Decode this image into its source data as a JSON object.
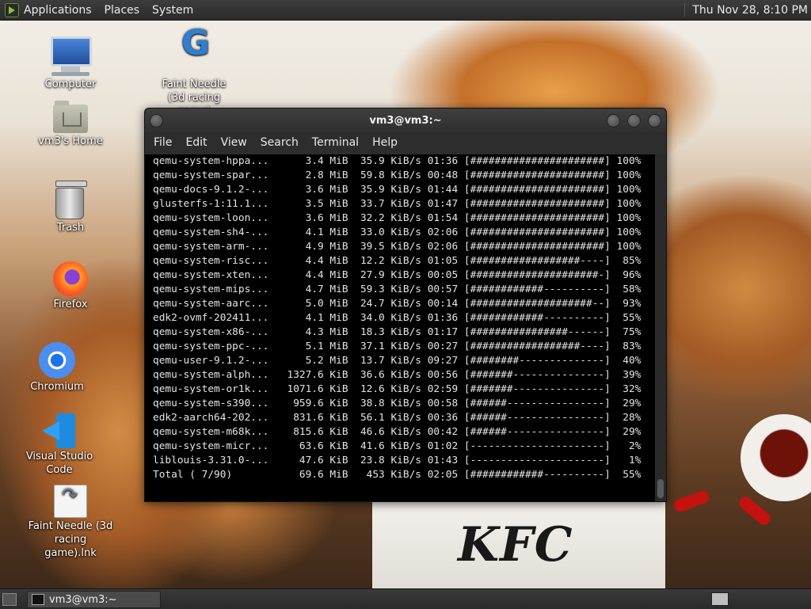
{
  "top_panel": {
    "menus": [
      "Applications",
      "Places",
      "System"
    ],
    "clock": "Thu Nov 28,  8:10 PM"
  },
  "desktop_icons": [
    {
      "label": "Computer",
      "icon": "computer-icon"
    },
    {
      "label": "Faint Needle (3d racing game)",
      "icon": "game-icon"
    },
    {
      "label": "vm3's Home",
      "icon": "home-folder-icon"
    },
    {
      "label": "Trash",
      "icon": "trash-icon"
    },
    {
      "label": "Firefox",
      "icon": "firefox-icon"
    },
    {
      "label": "Chromium",
      "icon": "chromium-icon"
    },
    {
      "label": "Visual Studio Code",
      "icon": "vscode-icon"
    },
    {
      "label": "Faint Needle (3d racing game).lnk",
      "icon": "shortcut-file-icon"
    }
  ],
  "wallpaper": {
    "brand_text": "KFC"
  },
  "terminal": {
    "title": "vm3@vm3:~",
    "menu": [
      "File",
      "Edit",
      "View",
      "Search",
      "Terminal",
      "Help"
    ],
    "lines": [
      "qemu-system-hppa...      3.4 MiB  35.9 KiB/s 01:36 [######################] 100%",
      "qemu-system-spar...      2.8 MiB  59.8 KiB/s 00:48 [######################] 100%",
      "qemu-docs-9.1.2-...      3.6 MiB  35.9 KiB/s 01:44 [######################] 100%",
      "glusterfs-1:11.1...      3.5 MiB  33.7 KiB/s 01:47 [######################] 100%",
      "qemu-system-loon...      3.6 MiB  32.2 KiB/s 01:54 [######################] 100%",
      "qemu-system-sh4-...      4.1 MiB  33.0 KiB/s 02:06 [######################] 100%",
      "qemu-system-arm-...      4.9 MiB  39.5 KiB/s 02:06 [######################] 100%",
      "qemu-system-risc...      4.4 MiB  12.2 KiB/s 01:05 [##################----]  85%",
      "qemu-system-xten...      4.4 MiB  27.9 KiB/s 00:05 [#####################-]  96%",
      "qemu-system-mips...      4.7 MiB  59.3 KiB/s 00:57 [############----------]  58%",
      "qemu-system-aarc...      5.0 MiB  24.7 KiB/s 00:14 [####################--]  93%",
      "edk2-ovmf-202411...      4.1 MiB  34.0 KiB/s 01:36 [############----------]  55%",
      "qemu-system-x86-...      4.3 MiB  18.3 KiB/s 01:17 [################------]  75%",
      "qemu-system-ppc-...      5.1 MiB  37.1 KiB/s 00:27 [##################----]  83%",
      "qemu-user-9.1.2-...      5.2 MiB  13.7 KiB/s 09:27 [########--------------]  40%",
      "qemu-system-alph...   1327.6 KiB  36.6 KiB/s 00:56 [#######---------------]  39%",
      "qemu-system-or1k...   1071.6 KiB  12.6 KiB/s 02:59 [#######---------------]  32%",
      "qemu-system-s390...    959.6 KiB  38.8 KiB/s 00:58 [######----------------]  29%",
      "edk2-aarch64-202...    831.6 KiB  56.1 KiB/s 00:36 [######----------------]  28%",
      "qemu-system-m68k...    815.6 KiB  46.6 KiB/s 00:42 [######----------------]  29%",
      "qemu-system-micr...     63.6 KiB  41.6 KiB/s 01:02 [----------------------]   2%",
      "liblouis-3.31.0-...     47.6 KiB  23.8 KiB/s 01:43 [----------------------]   1%",
      "Total ( 7/90)           69.6 MiB   453 KiB/s 02:05 [############----------]  55%"
    ]
  },
  "taskbar": {
    "task_label": "vm3@vm3:~"
  },
  "colors": {
    "terminal_bg": "#000000",
    "terminal_fg": "#e4e4e4",
    "panel_bg": "#2f2f2f"
  }
}
